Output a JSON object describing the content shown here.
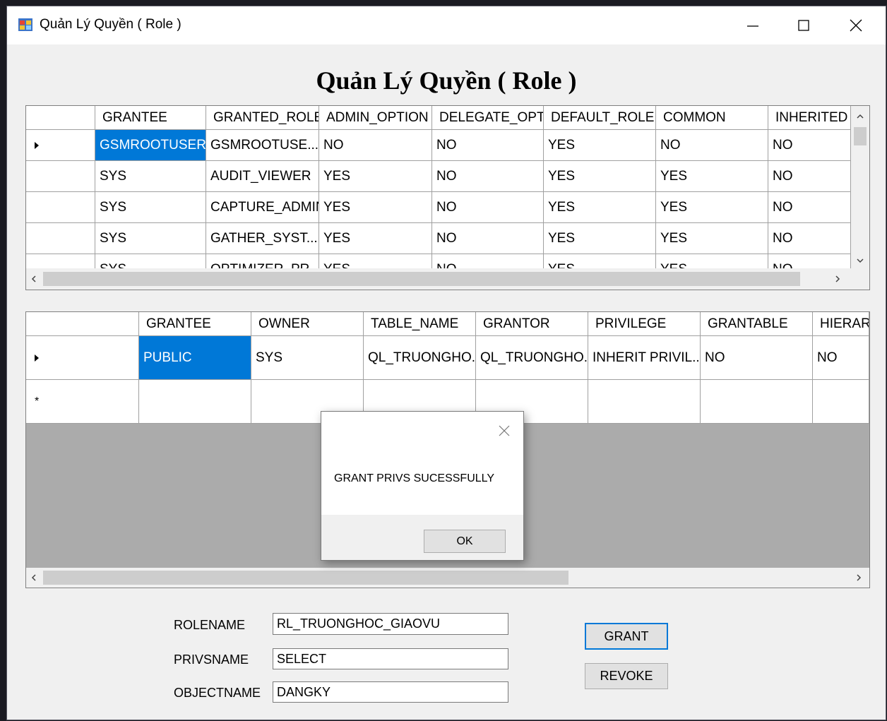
{
  "window": {
    "title": "Quản Lý Quyền ( Role )",
    "heading": "Quản Lý Quyền ( Role )"
  },
  "roles_grid": {
    "columns": [
      "GRANTEE",
      "GRANTED_ROLE",
      "ADMIN_OPTION",
      "DELEGATE_OPTIC",
      "DEFAULT_ROLE",
      "COMMON",
      "INHERITED"
    ],
    "rows": [
      [
        "GSMROOTUSER",
        "GSMROOTUSE...",
        "NO",
        "NO",
        "YES",
        "NO",
        "NO"
      ],
      [
        "SYS",
        "AUDIT_VIEWER",
        "YES",
        "NO",
        "YES",
        "YES",
        "NO"
      ],
      [
        "SYS",
        "CAPTURE_ADMIN",
        "YES",
        "NO",
        "YES",
        "YES",
        "NO"
      ],
      [
        "SYS",
        "GATHER_SYST...",
        "YES",
        "NO",
        "YES",
        "YES",
        "NO"
      ],
      [
        "SYS",
        "OPTIMIZER_PR...",
        "YES",
        "NO",
        "YES",
        "YES",
        "NO"
      ]
    ]
  },
  "privs_grid": {
    "columns": [
      "GRANTEE",
      "OWNER",
      "TABLE_NAME",
      "GRANTOR",
      "PRIVILEGE",
      "GRANTABLE",
      "HIERARCHY"
    ],
    "rows": [
      [
        "PUBLIC",
        "SYS",
        "QL_TRUONGHO...",
        "QL_TRUONGHO...",
        "INHERIT PRIVIL...",
        "NO",
        "NO"
      ]
    ],
    "new_row_marker": "*"
  },
  "message_box": {
    "message": "GRANT PRIVS SUCESSFULLY",
    "ok_label": "OK"
  },
  "form": {
    "rolename_label": "ROLENAME",
    "rolename_value": "RL_TRUONGHOC_GIAOVU",
    "privsname_label": "PRIVSNAME",
    "privsname_value": "SELECT",
    "objectname_label": "OBJECTNAME",
    "objectname_value": "DANGKY",
    "grant_label": "GRANT",
    "revoke_label": "REVOKE"
  },
  "icons": {
    "app": "app-icon",
    "minimize": "minimize-icon",
    "maximize": "maximize-icon",
    "close": "close-icon",
    "current_row": "row-pointer-icon"
  },
  "colors": {
    "selection": "#0078d7",
    "window_bg": "#f0f0f0",
    "grid_empty": "#ababab"
  }
}
